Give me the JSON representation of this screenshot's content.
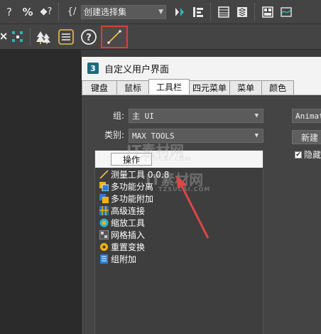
{
  "toolbar": {
    "selection_set": "创建选择集",
    "icons": [
      "help-query-icon",
      "percent-snap-icon",
      "spinner-snap-icon",
      "edit-named-selection-icon",
      "mirror-icon",
      "align-icon",
      "scene-explorer-icon",
      "layer-explorer-icon",
      "ribbon-icon",
      "curve-editor-icon"
    ]
  },
  "toolbar2": {
    "icons": [
      "select-and-place-icon",
      "snap-toggle-icon",
      "tree-icon",
      "list-icon",
      "help-icon",
      "measure-tool-icon"
    ]
  },
  "dialog": {
    "title": "自定义用户界面",
    "app_icon_text": "3",
    "tabs": [
      "键盘",
      "鼠标",
      "工具栏",
      "四元菜单",
      "菜单",
      "颜色"
    ],
    "active_tab": "工具栏",
    "group_label": "组:",
    "group_value": "主 UI",
    "category_label": "类别:",
    "category_value": "MAX TOOLS",
    "right_combo": "Animat",
    "new_button": "新建",
    "hide_checkbox": "隐藏",
    "actions_header": "操作",
    "actions": [
      {
        "label": "测量工具 0.0.8",
        "icon": "ruler-line-icon"
      },
      {
        "label": "多功能分离",
        "icon": "detach-icon"
      },
      {
        "label": "多功能附加",
        "icon": "attach-icon"
      },
      {
        "label": "高级连接",
        "icon": "connect-icon"
      },
      {
        "label": "缩放工具",
        "icon": "scale-icon"
      },
      {
        "label": "网格插入",
        "icon": "grid-insert-icon"
      },
      {
        "label": "重置变换",
        "icon": "reset-xform-icon"
      },
      {
        "label": "组附加",
        "icon": "group-attach-icon"
      }
    ]
  },
  "watermark": {
    "text1": "IT素材网",
    "text2": "TZSUCAI.COM"
  },
  "colors": {
    "highlight": "#e23a3a",
    "arrow": "#e04646"
  }
}
